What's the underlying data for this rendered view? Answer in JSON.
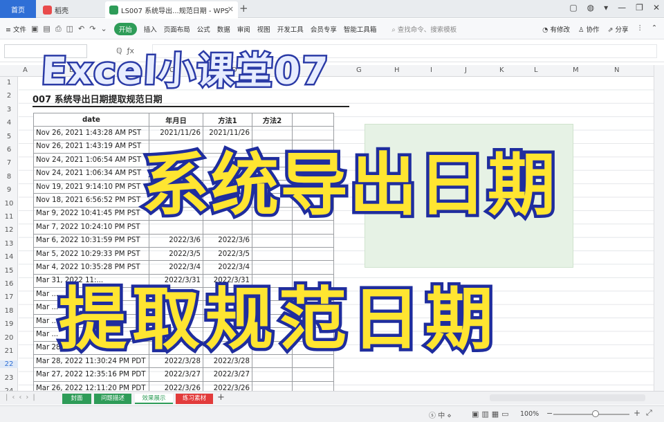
{
  "titlebar": {
    "tabs": [
      {
        "label": "首页",
        "icon": "home-icon"
      },
      {
        "label": "稻壳",
        "icon": "docer-icon"
      },
      {
        "label": "LS007 系统导出...规范日期 - WPS",
        "icon": "sheet-doc-icon"
      }
    ],
    "colors": {
      "home_tab": "#2f6fd6",
      "docer_icon": "#e94b4b",
      "doc_icon": "#2e9c58"
    }
  },
  "ribbon": {
    "menu_label": "文件",
    "tabs": [
      "开始",
      "插入",
      "页面布局",
      "公式",
      "数据",
      "审阅",
      "视图",
      "开发工具",
      "会员专享",
      "智能工具箱"
    ],
    "active_tab": "开始",
    "search_placeholder": "查找命令、搜索模板",
    "right_items": [
      "有修改",
      "协作",
      "分享"
    ]
  },
  "columns": [
    "A",
    "B",
    "C",
    "D",
    "E",
    "F",
    "G",
    "H",
    "I",
    "J",
    "K",
    "L",
    "M",
    "N"
  ],
  "rows": [
    "1",
    "2",
    "3",
    "4",
    "5",
    "6",
    "7",
    "8",
    "9",
    "10",
    "11",
    "12",
    "13",
    "14",
    "15",
    "16",
    "17",
    "18",
    "19",
    "20",
    "21",
    "22",
    "23",
    "24"
  ],
  "active_row": "22",
  "sheet": {
    "title": "007 系统导出日期提取规范日期",
    "table_headers": [
      "date",
      "年月日",
      "方法1",
      "方法2"
    ],
    "table_rows": [
      [
        "Nov 26, 2021 1:43:28 AM PST",
        "2021/11/26",
        "2021/11/26",
        ""
      ],
      [
        "Nov 26, 2021 1:43:19 AM PST",
        "",
        "",
        ""
      ],
      [
        "Nov 24, 2021 1:06:54 AM PST",
        "",
        "",
        ""
      ],
      [
        "Nov 24, 2021 1:06:34 AM PST",
        "",
        "",
        ""
      ],
      [
        "Nov 19, 2021 9:14:10 PM PST",
        "",
        "",
        ""
      ],
      [
        "Nov 18, 2021 6:56:52 PM PST",
        "",
        "",
        ""
      ],
      [
        "Mar 9, 2022 10:41:45 PM PST",
        "",
        "",
        ""
      ],
      [
        "Mar 7, 2022 10:24:10 PM PST",
        "",
        "",
        ""
      ],
      [
        "Mar 6, 2022 10:31:59 PM PST",
        "2022/3/6",
        "2022/3/6",
        ""
      ],
      [
        "Mar 5, 2022 10:29:33 PM PST",
        "2022/3/5",
        "2022/3/5",
        ""
      ],
      [
        "Mar 4, 2022 10:35:28 PM PST",
        "2022/3/4",
        "2022/3/4",
        ""
      ],
      [
        "Mar 31, 2022 11:...",
        "2022/3/31",
        "2022/3/31",
        ""
      ],
      [
        "Mar ...",
        "",
        "",
        ""
      ],
      [
        "Mar ...",
        "",
        "",
        ""
      ],
      [
        "Mar ...",
        "",
        "",
        ""
      ],
      [
        "Mar ...",
        "",
        "",
        ""
      ],
      [
        "Mar 28, ...",
        "",
        "",
        ""
      ],
      [
        "Mar 28, 2022 11:30:24 PM PDT",
        "2022/3/28",
        "2022/3/28",
        ""
      ],
      [
        "Mar 27, 2022 12:35:16 PM PDT",
        "2022/3/27",
        "2022/3/27",
        ""
      ],
      [
        "Mar 26, 2022 12:11:20 PM PDT",
        "2022/3/26",
        "2022/3/26",
        ""
      ]
    ]
  },
  "note_box_color": "#e6f2e5",
  "sheet_tabs": [
    {
      "label": "封面",
      "color": "#2e9c58"
    },
    {
      "label": "问题描述",
      "color": "#2e9c58"
    },
    {
      "label": "效果展示",
      "color": "#ffffff",
      "active": true
    },
    {
      "label": "练习素材",
      "color": "#e23b3b"
    }
  ],
  "statusbar": {
    "input_mode": "中",
    "zoom": "100%"
  },
  "overlay": {
    "course": "Excel小课堂07",
    "line1": "系统导出日期",
    "line2": "提取规范日期"
  }
}
